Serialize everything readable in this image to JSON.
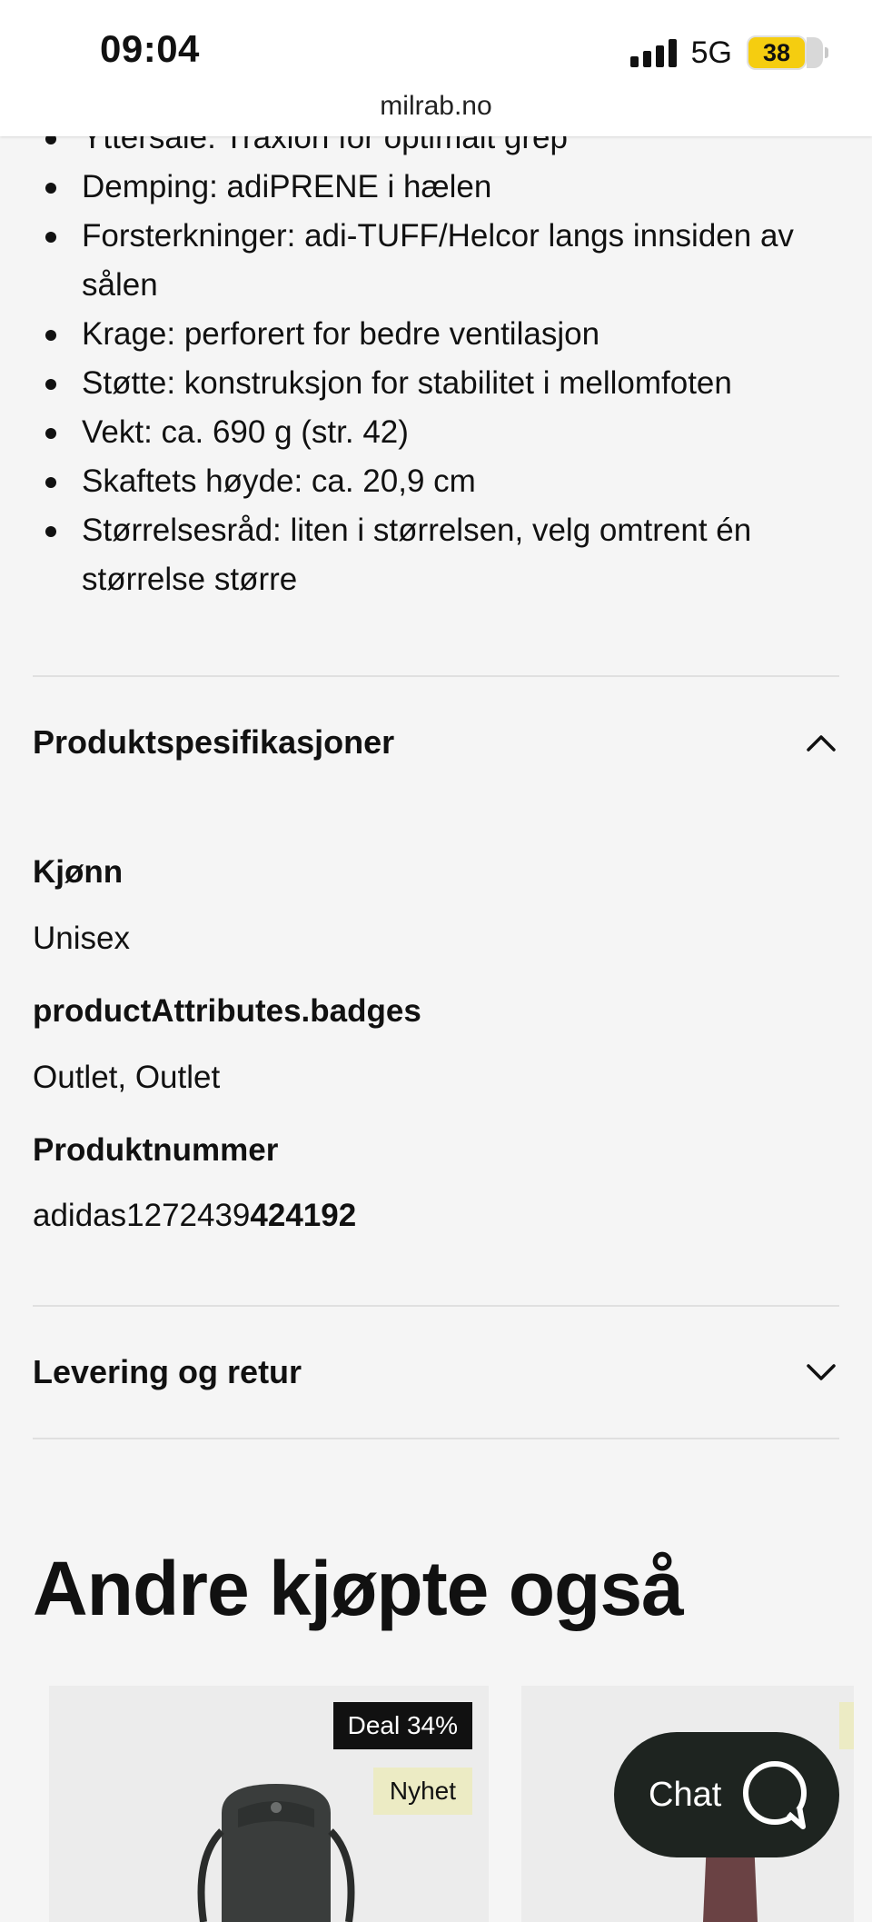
{
  "status_bar": {
    "time": "09:04",
    "network": "5G",
    "battery": "38",
    "url": "milrab.no"
  },
  "features": [
    "Yttersåle: Traxion for optimalt grep",
    "Demping: adiPRENE i hælen",
    "Forsterkninger: adi-TUFF/Helcor langs innsiden av sålen",
    "Krage: perforert for bedre ventilasjon",
    "Støtte: konstruksjon for stabilitet i mellomfoten",
    "Vekt: ca. 690 g (str. 42)",
    "Skaftets høyde: ca. 20,9 cm",
    "Størrelsesråd: liten i størrelsen, velg omtrent én størrelse større"
  ],
  "specs": {
    "heading": "Produktspesifikasjoner",
    "items": [
      {
        "label": "Kjønn",
        "value": "Unisex"
      },
      {
        "label": "productAttributes.badges",
        "value": "Outlet, Outlet"
      },
      {
        "label": "Produktnummer",
        "value_prefix": "adidas1272439",
        "value_bold": "424192"
      }
    ]
  },
  "delivery": {
    "heading": "Levering og retur"
  },
  "related": {
    "heading": "Andre kjøpte også",
    "cards": [
      {
        "deal_badge": "Deal 34%",
        "new_badge": "Nyhet",
        "icon": "backpack-image"
      },
      {
        "icon": "product-image"
      }
    ]
  },
  "chat": {
    "label": "Chat",
    "icon": "chat-bubble-icon",
    "bg_color": "#1e2420"
  },
  "colors": {
    "battery": "#f5cd10",
    "deal_badge_bg": "#111111",
    "new_badge_bg": "#ecebc4",
    "page_bg": "#f5f5f5"
  }
}
